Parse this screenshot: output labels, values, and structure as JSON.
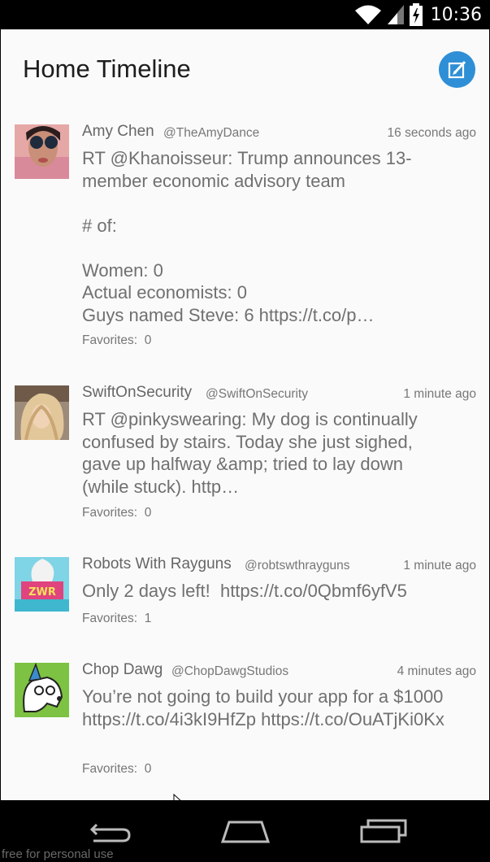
{
  "status_bar": {
    "time": "10:36",
    "icons": [
      "wifi-icon",
      "cell-signal-icon",
      "battery-charging-icon"
    ]
  },
  "header": {
    "title": "Home Timeline",
    "compose_icon": "compose-icon",
    "accent_color": "#2f8fd6"
  },
  "tweets": [
    {
      "name": "Amy Chen",
      "handle": "@TheAmyDance",
      "time": "16 seconds ago",
      "text": "RT @Khanoisseur: Trump announces 13-member economic advisory team\n\n# of:\n\nWomen: 0\nActual economists: 0\nGuys named Steve: 6 https://t.co/p…",
      "favorites_label": "Favorites:",
      "favorites": "0"
    },
    {
      "name": "SwiftOnSecurity",
      "handle": "@SwiftOnSecurity",
      "time": "1 minute ago",
      "text": "RT @pinkyswearing: My dog is continually confused by stairs. Today she just sighed, gave up halfway &amp; tried to lay down (while stuck). http…",
      "favorites_label": "Favorites:",
      "favorites": "0"
    },
    {
      "name": "Robots With Rayguns",
      "handle": "@robtswthrayguns",
      "time": "1 minute ago",
      "text": "Only 2 days left!  https://t.co/0Qbmf6yfV5",
      "favorites_label": "Favorites:",
      "favorites": "1"
    },
    {
      "name": "Chop Dawg",
      "handle": "@ChopDawgStudios",
      "time": "4 minutes ago",
      "text": "You’re not going to build your app for a $1000 https://t.co/4i3kI9HfZp https://t.co/OuATjKi0Kx",
      "favorites_label": "Favorites:",
      "favorites": "0"
    }
  ],
  "nav_bar": {
    "icons": [
      "back-icon",
      "home-icon",
      "recents-icon"
    ]
  },
  "watermark": "free for personal use"
}
